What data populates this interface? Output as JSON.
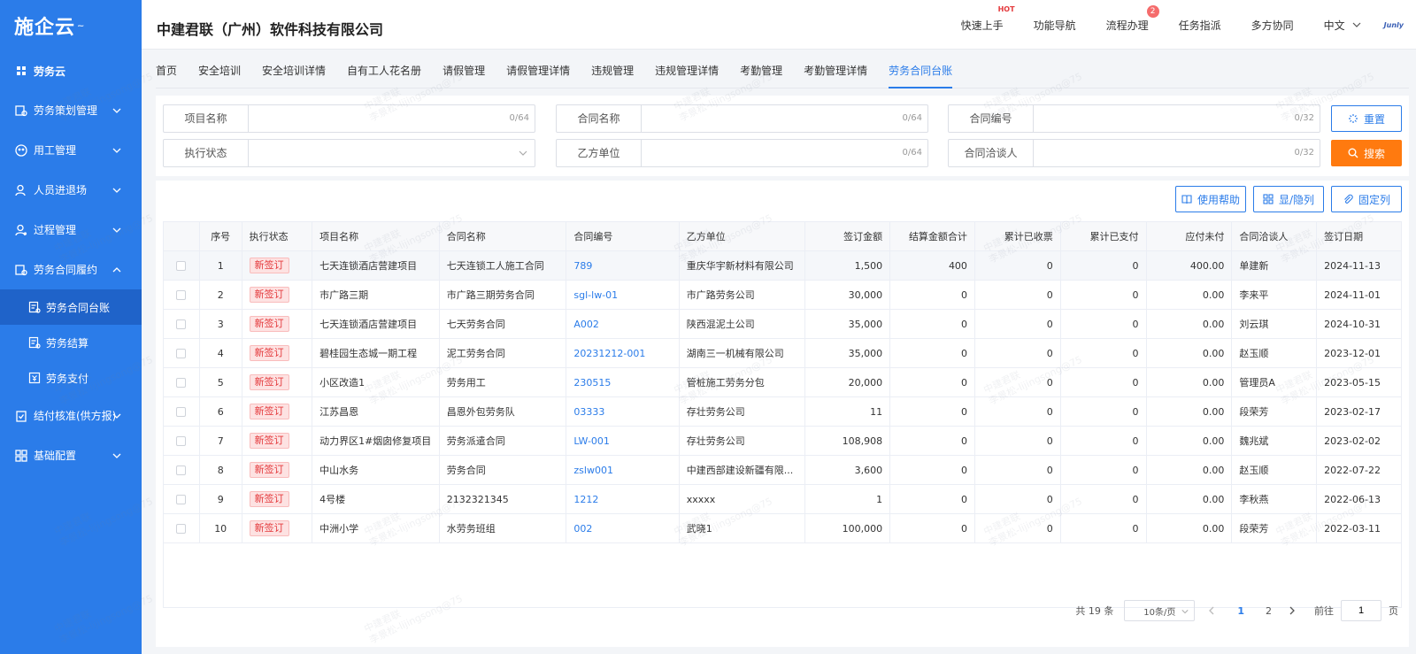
{
  "logo": {
    "text": "施企云"
  },
  "sidebar": {
    "items": [
      {
        "label": "劳务云"
      },
      {
        "label": "劳务策划管理"
      },
      {
        "label": "用工管理"
      },
      {
        "label": "人员进退场"
      },
      {
        "label": "过程管理"
      },
      {
        "label": "劳务合同履约"
      },
      {
        "label": "结付核准(供方报)"
      },
      {
        "label": "基础配置"
      }
    ],
    "subitems": [
      {
        "label": "劳务合同台账"
      },
      {
        "label": "劳务结算"
      },
      {
        "label": "劳务支付"
      }
    ]
  },
  "header": {
    "company": "中建君联（广州）软件科技有限公司",
    "links": [
      "快速上手",
      "功能导航",
      "流程办理",
      "任务指派",
      "多方协同"
    ],
    "hot": "HOT",
    "badge": "2",
    "lang": "中文",
    "brand": "Junly"
  },
  "tabs": [
    "首页",
    "安全培训",
    "安全培训详情",
    "自有工人花名册",
    "请假管理",
    "请假管理详情",
    "违规管理",
    "违规管理详情",
    "考勤管理",
    "考勤管理详情",
    "劳务合同台账"
  ],
  "filters": {
    "project_name": {
      "label": "项目名称",
      "count": "0/64"
    },
    "contract_name": {
      "label": "合同名称",
      "count": "0/64"
    },
    "contract_no": {
      "label": "合同编号",
      "count": "0/32"
    },
    "exec_status": {
      "label": "执行状态"
    },
    "party_b": {
      "label": "乙方单位",
      "count": "0/64"
    },
    "negotiator": {
      "label": "合同洽谈人",
      "count": "0/32"
    },
    "reset": "重置",
    "search": "搜索"
  },
  "toolbar": {
    "help": "使用帮助",
    "toggle_cols": "显/隐列",
    "fix_cols": "固定列"
  },
  "table": {
    "headers": [
      "序号",
      "执行状态",
      "项目名称",
      "合同名称",
      "合同编号",
      "乙方单位",
      "签订金额",
      "结算金额合计",
      "累计已收票",
      "累计已支付",
      "应付未付",
      "合同洽谈人",
      "签订日期"
    ],
    "rows": [
      {
        "no": "1",
        "status": "新签订",
        "project": "七天连锁酒店营建项目",
        "contract": "七天连锁工人施工合同",
        "code": "789",
        "partyb": "重庆华宇新材料有限公司",
        "signed": "1,500",
        "settled": "400",
        "invoiced": "0",
        "paid": "0",
        "unpaid": "400.00",
        "negotiator": "单建新",
        "date": "2024-11-13"
      },
      {
        "no": "2",
        "status": "新签订",
        "project": "市广路三期",
        "contract": "市广路三期劳务合同",
        "code": "sgl-lw-01",
        "partyb": "市广路劳务公司",
        "signed": "30,000",
        "settled": "0",
        "invoiced": "0",
        "paid": "0",
        "unpaid": "0.00",
        "negotiator": "李来平",
        "date": "2024-11-01"
      },
      {
        "no": "3",
        "status": "新签订",
        "project": "七天连锁酒店营建项目",
        "contract": "七天劳务合同",
        "code": "A002",
        "partyb": "陕西混泥土公司",
        "signed": "35,000",
        "settled": "0",
        "invoiced": "0",
        "paid": "0",
        "unpaid": "0.00",
        "negotiator": "刘云琪",
        "date": "2024-10-31"
      },
      {
        "no": "4",
        "status": "新签订",
        "project": "碧桂园生态城一期工程",
        "contract": "泥工劳务合同",
        "code": "20231212-001",
        "partyb": "湖南三一机械有限公司",
        "signed": "35,000",
        "settled": "0",
        "invoiced": "0",
        "paid": "0",
        "unpaid": "0.00",
        "negotiator": "赵玉顺",
        "date": "2023-12-01"
      },
      {
        "no": "5",
        "status": "新签订",
        "project": "小区改造1",
        "contract": "劳务用工",
        "code": "230515",
        "partyb": "管桩施工劳务分包",
        "signed": "20,000",
        "settled": "0",
        "invoiced": "0",
        "paid": "0",
        "unpaid": "0.00",
        "negotiator": "管理员A",
        "date": "2023-05-15"
      },
      {
        "no": "6",
        "status": "新签订",
        "project": "江苏昌恩",
        "contract": "昌恩外包劳务队",
        "code": "03333",
        "partyb": "存壮劳务公司",
        "signed": "11",
        "settled": "0",
        "invoiced": "0",
        "paid": "0",
        "unpaid": "0.00",
        "negotiator": "段荣芳",
        "date": "2023-02-17"
      },
      {
        "no": "7",
        "status": "新签订",
        "project": "动力界区1#烟囱修复项目",
        "contract": "劳务派遣合同",
        "code": "LW-001",
        "partyb": "存壮劳务公司",
        "signed": "108,908",
        "settled": "0",
        "invoiced": "0",
        "paid": "0",
        "unpaid": "0.00",
        "negotiator": "魏兆斌",
        "date": "2023-02-02"
      },
      {
        "no": "8",
        "status": "新签订",
        "project": "中山水务",
        "contract": "劳务合同",
        "code": "zslw001",
        "partyb": "中建西部建设新疆有限...",
        "signed": "3,600",
        "settled": "0",
        "invoiced": "0",
        "paid": "0",
        "unpaid": "0.00",
        "negotiator": "赵玉顺",
        "date": "2022-07-22"
      },
      {
        "no": "9",
        "status": "新签订",
        "project": "4号楼",
        "contract": "2132321345",
        "code": "1212",
        "partyb": "xxxxx",
        "signed": "1",
        "settled": "0",
        "invoiced": "0",
        "paid": "0",
        "unpaid": "0.00",
        "negotiator": "李秋燕",
        "date": "2022-06-13"
      },
      {
        "no": "10",
        "status": "新签订",
        "project": "中洲小学",
        "contract": "水劳务班组",
        "code": "002",
        "partyb": "武晓1",
        "signed": "100,000",
        "settled": "0",
        "invoiced": "0",
        "paid": "0",
        "unpaid": "0.00",
        "negotiator": "段荣芳",
        "date": "2022-03-11"
      }
    ]
  },
  "pager": {
    "total": "共 19 条",
    "page_size": "10条/页",
    "pages": [
      "1",
      "2"
    ],
    "goto_label": "前往",
    "goto_value": "1",
    "page_unit": "页"
  },
  "watermark": {
    "line1": "中建君联",
    "line2": "李景松-lijingsong@75"
  },
  "colors": {
    "primary": "#2b7ce9",
    "sidebar_active": "#1f63c9",
    "search_button": "#ff7a0f",
    "status_text": "#e4393c"
  }
}
